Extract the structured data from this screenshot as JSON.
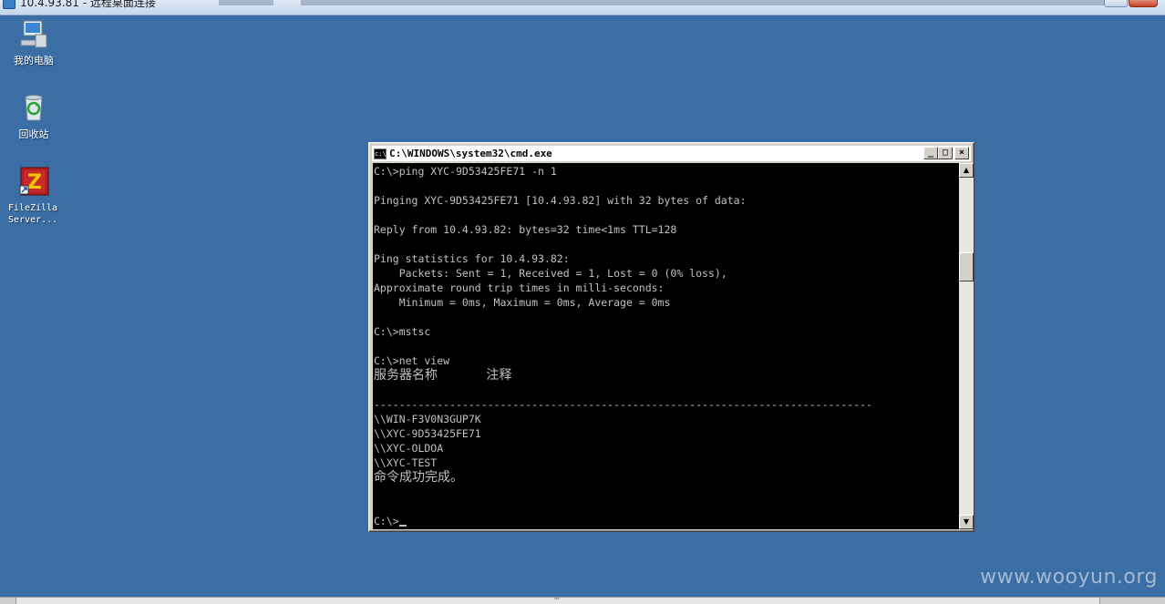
{
  "rdp": {
    "title": "10.4.93.81 - 远程桌面连接"
  },
  "desktop": {
    "icons": [
      {
        "label": "我的电脑",
        "icon": "computer-icon"
      },
      {
        "label": "回收站",
        "icon": "recycle-bin-icon"
      },
      {
        "label": "FileZilla\nServer...",
        "icon": "filezilla-server-icon"
      }
    ]
  },
  "cmd": {
    "title": "C:\\WINDOWS\\system32\\cmd.exe",
    "buttons": {
      "minimize": "_",
      "maximize": "□",
      "close": "×"
    },
    "lines": [
      "C:\\>ping XYC-9D53425FE71 -n 1",
      "",
      "Pinging XYC-9D53425FE71 [10.4.93.82] with 32 bytes of data:",
      "",
      "Reply from 10.4.93.82: bytes=32 time<1ms TTL=128",
      "",
      "Ping statistics for 10.4.93.82:",
      "    Packets: Sent = 1, Received = 1, Lost = 0 (0% loss),",
      "Approximate round trip times in milli-seconds:",
      "    Minimum = 0ms, Maximum = 0ms, Average = 0ms",
      "",
      "C:\\>mstsc",
      "",
      "C:\\>net view",
      "服务器名称            注释",
      "",
      "-------------------------------------------------------------------------------",
      "\\\\WIN-F3V0N3GUP7K",
      "\\\\XYC-9D53425FE71",
      "\\\\XYC-OLDOA",
      "\\\\XYC-TEST",
      "命令成功完成。",
      "",
      ""
    ],
    "prompt": "C:\\>"
  },
  "watermark": "www.wooyun.org",
  "bottom_bar": {
    "mark": "'''"
  }
}
